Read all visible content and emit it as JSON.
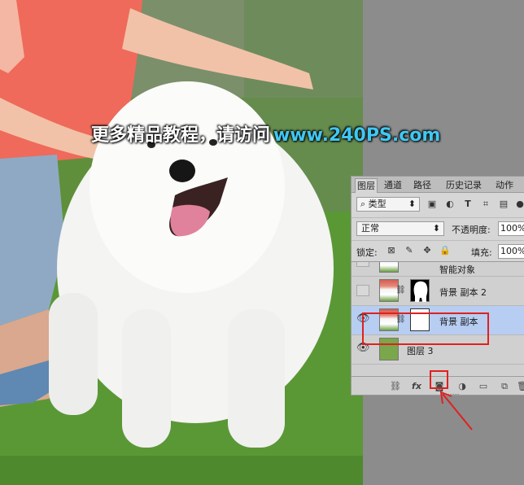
{
  "watermark": {
    "text_cn": "更多精品教程，请访问",
    "url": "www.240PS.com"
  },
  "colors": {
    "accent_url": "#3fc8f3",
    "selection": "#b7cdf2",
    "annotation_red": "#e02020"
  },
  "panel": {
    "tabs": [
      "图层",
      "通道",
      "路径",
      "历史记录",
      "动作"
    ],
    "active_tab": "图层",
    "filter": {
      "label": "类型",
      "icons": [
        "image-filter-icon",
        "adjustment-filter-icon",
        "type-filter-icon",
        "shape-filter-icon",
        "smart-object-filter-icon"
      ]
    },
    "blend_mode": "正常",
    "opacity_label": "不透明度:",
    "opacity_value": "100%",
    "lock_label": "锁定:",
    "fill_label": "填充:",
    "fill_value": "100%",
    "layers": [
      {
        "name": "智能对象",
        "visible": false,
        "selected": false,
        "partial": true
      },
      {
        "name": "背景 副本 2",
        "visible": false,
        "selected": false,
        "mask": "black-with-white-dog"
      },
      {
        "name": "背景 副本",
        "visible": true,
        "selected": true,
        "mask": "white"
      },
      {
        "name": "图层 3",
        "visible": true,
        "selected": false,
        "fill": "green"
      }
    ],
    "footer_icons": [
      "link-icon",
      "fx-icon",
      "add-mask-icon",
      "adjustment-icon",
      "folder-icon",
      "new-layer-icon",
      "trash-icon"
    ]
  }
}
